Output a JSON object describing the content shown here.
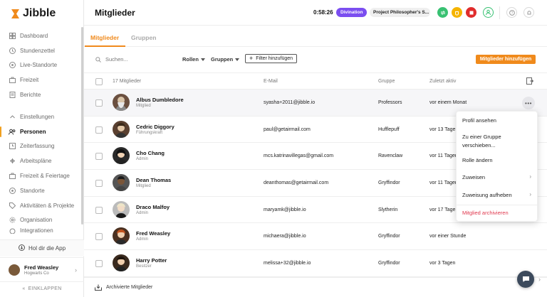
{
  "app": {
    "name": "Jibble"
  },
  "sidebar": {
    "items": [
      {
        "label": "Dashboard",
        "icon": "dashboard-icon"
      },
      {
        "label": "Stundenzettel",
        "icon": "clock-icon"
      },
      {
        "label": "Live-Standorte",
        "icon": "location-icon"
      },
      {
        "label": "Freizeit",
        "icon": "suitcase-icon"
      },
      {
        "label": "Berichte",
        "icon": "report-icon"
      },
      {
        "label": "Einstellungen",
        "icon": "chevron-up-icon"
      },
      {
        "label": "Personen",
        "icon": "people-icon"
      },
      {
        "label": "Zeiterfassung",
        "icon": "time-tracking-icon"
      },
      {
        "label": "Arbeitspläne",
        "icon": "schedule-icon"
      },
      {
        "label": "Freizeit & Feiertage",
        "icon": "holiday-icon"
      },
      {
        "label": "Standorte",
        "icon": "location-icon"
      },
      {
        "label": "Aktivitäten & Projekte",
        "icon": "tag-icon"
      },
      {
        "label": "Organisation",
        "icon": "gear-icon"
      },
      {
        "label": "Integrationen",
        "icon": "integration-icon"
      }
    ],
    "get_app": "Hol dir die App",
    "user": {
      "name": "Fred Weasley",
      "org": "Hogwarts Co"
    },
    "collapse": "EINKLAPPEN"
  },
  "header": {
    "title": "Mitglieder",
    "timer": "0:58:26",
    "activity": "Divination",
    "project": "Project Philosopher's S..."
  },
  "tabs": [
    "Mitglieder",
    "Gruppen"
  ],
  "toolbar": {
    "search_placeholder": "Suchen...",
    "roles": "Rollen",
    "groups": "Gruppen",
    "filter": "Filter hinzufügen",
    "add": "Mitglieder hinzufügen"
  },
  "table": {
    "count_label": "17 Mitglieder",
    "columns": {
      "email": "E-Mail",
      "group": "Gruppe",
      "last_active": "Zuletzt aktiv"
    },
    "rows": [
      {
        "name": "Albus Dumbledore",
        "role": "Mitglied",
        "email": "syasha+2011@jibble.io",
        "group": "Professors",
        "last": "vor einem Monat"
      },
      {
        "name": "Cedric Diggory",
        "role": "Führungskraft",
        "email": "paul@getairmail.com",
        "group": "Hufflepuff",
        "last": "vor 13 Tagen"
      },
      {
        "name": "Cho Chang",
        "role": "Admin",
        "email": "mcs.katrinavillegas@gmail.com",
        "group": "Ravenclaw",
        "last": "vor 11 Tagen"
      },
      {
        "name": "Dean Thomas",
        "role": "Mitglied",
        "email": "deanthomas@getairmail.com",
        "group": "Gryffindor",
        "last": "vor 11 Tagen"
      },
      {
        "name": "Draco Malfoy",
        "role": "Admin",
        "email": "maryamk@jibble.io",
        "group": "Slytherin",
        "last": "vor 17 Tagen"
      },
      {
        "name": "Fred Weasley",
        "role": "Admin",
        "email": "michaera@jibble.io",
        "group": "Gryffindor",
        "last": "vor einer Stunde"
      },
      {
        "name": "Harry Potter",
        "role": "Besitzer",
        "email": "melissa+32@jibble.io",
        "group": "Gryffindor",
        "last": "vor 3 Tagen"
      }
    ]
  },
  "context_menu": {
    "items": [
      "Profil ansehen",
      "Zu einer Gruppe verschieben...",
      "Rolle ändern",
      "Zuweisen",
      "Zuweisung aufheben",
      "Mitglied archivieren"
    ]
  },
  "archived": "Archivierte Mitglieder",
  "colors": {
    "accent": "#f08a1c",
    "activity": "#7b4ef0",
    "danger": "#e0384e"
  }
}
